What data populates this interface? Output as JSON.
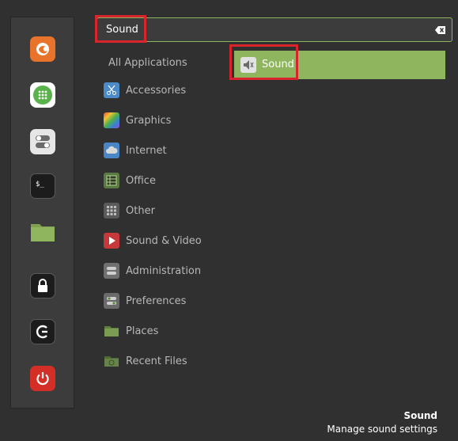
{
  "search": {
    "value": "Sound",
    "clear_icon": "backspace-clear-icon"
  },
  "favorites": [
    {
      "name": "firefox",
      "icon": "firefox-icon",
      "color": "#e8742c"
    },
    {
      "name": "software-manager",
      "icon": "grid-dots-icon",
      "color": "#5ab24a"
    },
    {
      "name": "system-settings",
      "icon": "toggle-switches-icon",
      "color": "#d7d7d7"
    },
    {
      "name": "terminal",
      "icon": "terminal-icon",
      "color": "#1f1f1f"
    },
    {
      "name": "files",
      "icon": "folder-icon",
      "color": "#8fb55e"
    },
    {
      "name": "lock-screen",
      "icon": "lock-icon",
      "color": "#1f1f1f"
    },
    {
      "name": "logout",
      "icon": "logout-icon",
      "color": "#1f1f1f"
    },
    {
      "name": "shutdown",
      "icon": "power-icon",
      "color": "#d42f26"
    }
  ],
  "categories": [
    {
      "label": "All Applications",
      "icon": ""
    },
    {
      "label": "Accessories",
      "icon": "scissors-icon"
    },
    {
      "label": "Graphics",
      "icon": "palette-icon"
    },
    {
      "label": "Internet",
      "icon": "cloud-icon"
    },
    {
      "label": "Office",
      "icon": "spreadsheet-icon"
    },
    {
      "label": "Other",
      "icon": "dots-grid-icon"
    },
    {
      "label": "Sound & Video",
      "icon": "play-icon"
    },
    {
      "label": "Administration",
      "icon": "admin-switches-icon"
    },
    {
      "label": "Preferences",
      "icon": "preferences-switches-icon"
    },
    {
      "label": "Places",
      "icon": "folder-icon"
    },
    {
      "label": "Recent Files",
      "icon": "recent-folder-icon"
    }
  ],
  "result": {
    "label": "Sound",
    "icon": "speaker-icon"
  },
  "footer": {
    "title": "Sound",
    "description": "Manage sound settings"
  },
  "colors": {
    "accent": "#8fb55e",
    "highlight": "#d8252c",
    "background": "#303030"
  }
}
